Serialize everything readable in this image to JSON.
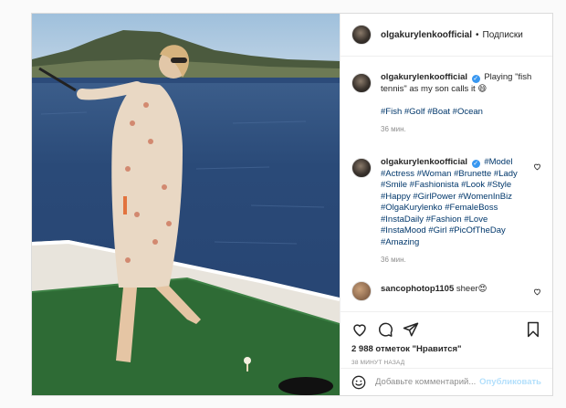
{
  "post": {
    "username": "olgakurylenkoofficial",
    "dot": "•",
    "follow_label": "Подписки"
  },
  "caption": {
    "username": "olgakurylenkoofficial",
    "text": "Playing \"fish tennis\" as my son calls it 😄",
    "tags": "#Fish #Golf #Boat #Ocean",
    "time": "36 мин."
  },
  "comment1": {
    "username": "olgakurylenkoofficial",
    "text": "#Model #Actress #Woman #Brunette #Lady #Smile #Fashionista #Look #Style #Happy #GirlPower #WomenInBiz #OlgaKurylenko #FemaleBoss #InstaDaily #Fashion #Love #InstaMood #Girl #PicOfTheDay #Amazing",
    "time": "36 мин."
  },
  "comment2": {
    "username": "sancophotop1105",
    "text": "sheer😍"
  },
  "likes": "2 988 отметок \"Нравится\"",
  "timestamp": "38 МИНУТ НАЗАД",
  "add_comment": {
    "placeholder": "Добавьте комментарий...",
    "publish_label": "Опубликовать"
  },
  "icons": [
    "more-icon",
    "heart-icon",
    "comment-icon",
    "share-icon",
    "bookmark-icon",
    "emoji-icon",
    "verified-icon"
  ]
}
